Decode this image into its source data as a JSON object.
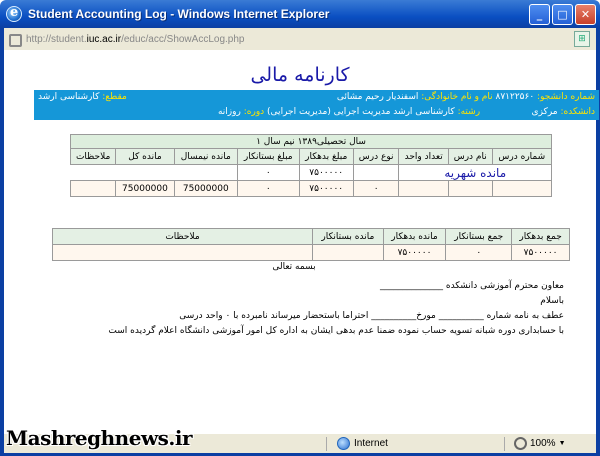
{
  "window": {
    "title": "Student Accounting Log - Windows Internet Explorer",
    "minimize_glyph": "_",
    "maximize_glyph": "□",
    "close_glyph": "✕"
  },
  "address": {
    "prefix": "http://student.",
    "domain": "iuc.ac.ir",
    "path": "/educ/acc/ShowAccLog.php"
  },
  "report": {
    "title": "کارنامه مالی"
  },
  "info": {
    "student_number_label": "شماره دانشجو:",
    "student_number": "۸۷۱۲۲۵۶۰",
    "full_name_label": "نام و نام خانوادگی:",
    "full_name": "اسفندیار رحیم مشائی",
    "level_label": "مقطع:",
    "level": "کارشناسی ارشد",
    "faculty_label": "دانشکده:",
    "faculty": "مرکزی",
    "major_label": "رشته:",
    "major": "کارشناسی ارشد مدیریت اجرایی (مدیریت اجرایی)",
    "course_type_label": "دوره:",
    "course_type": "روزانه"
  },
  "table1": {
    "caption": "سال تحصیلی۱۳۸۹ نیم سال ۱",
    "headers": [
      "شماره درس",
      "نام درس",
      "تعداد واحد",
      "نوع درس",
      "مبلغ بدهکار",
      "مبلغ بستانکار",
      "مانده نیمسال",
      "مانده کل",
      "ملاحظات"
    ],
    "student_name_cell": "مانده شهریه",
    "row1_debt": "۷۵۰۰۰۰۰",
    "row1_credit": "۰",
    "row2_type": "۰",
    "row2_debt": "۷۵۰۰۰۰۰",
    "row2_credit": "۰",
    "row2_semester_balance": "75000000",
    "row2_total_balance": "75000000"
  },
  "table2": {
    "headers": [
      "جمع بدهکار",
      "جمع بستانکار",
      "مانده بدهکار",
      "مانده بستانکار",
      "ملاحظات"
    ],
    "total_debt": "۷۵۰۰۰۰۰",
    "total_credit": "۰",
    "debt_balance": "۷۵۰۰۰۰۰"
  },
  "letter": {
    "bismillah": "بسمه تعالی",
    "line1": "معاون محترم آموزشی دانشکده ______________",
    "line2": "باسلام",
    "line3": "عطف به نامه شماره __________ مورخ__________ احتراما باستحضار میرساند نامبرده با ۰ واحد درسی",
    "line4": "با حسابداری دوره شبانه تسویه حساب نموده ضمنا عدم بدهی ایشان به اداره کل امور آموزشی دانشگاه اعلام گردیده است"
  },
  "status": {
    "zone": "Internet",
    "zoom": "100%",
    "zoom_arrow": "▼"
  },
  "watermark": "Mashreghnews.ir"
}
